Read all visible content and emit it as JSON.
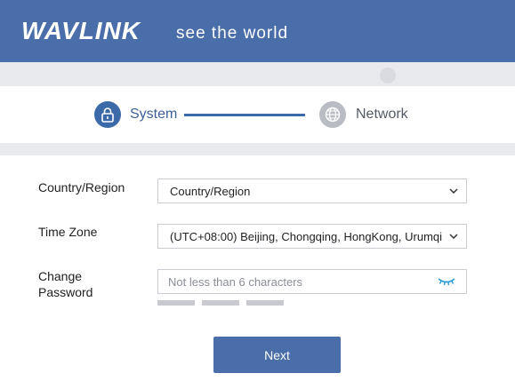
{
  "header": {
    "brand": "WAVLINK",
    "tagline": "see the world",
    "background": "#4a6ea9"
  },
  "steps": [
    {
      "label": "System",
      "icon": "lock-icon",
      "state": "active"
    },
    {
      "label": "Network",
      "icon": "globe-icon",
      "state": "inactive"
    }
  ],
  "form": {
    "country": {
      "label": "Country/Region",
      "value": "Country/Region"
    },
    "timezone": {
      "label": "Time Zone",
      "value": "(UTC+08:00) Beijing, Chongqing, HongKong, Urumqi"
    },
    "password": {
      "label_line1": "Change",
      "label_line2": "Password",
      "placeholder": "Not less than 6 characters",
      "value": ""
    },
    "strength_bars": 3
  },
  "buttons": {
    "next": "Next"
  },
  "colors": {
    "accent": "#4a6ea9",
    "step_active": "#3c6aa8",
    "step_inactive": "#b9bcc2",
    "eye_icon": "#2a9bd6"
  }
}
